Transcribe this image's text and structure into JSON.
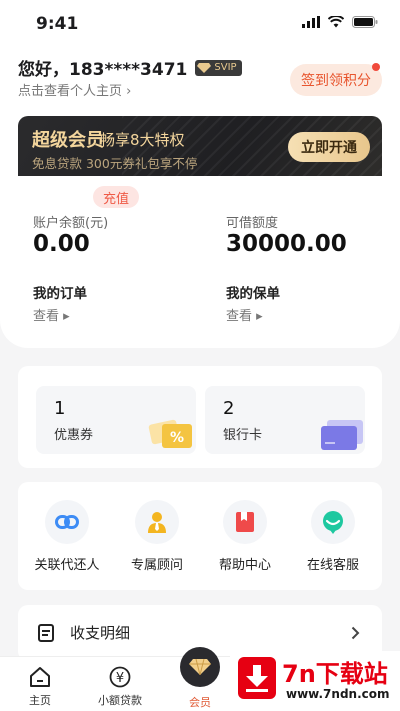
{
  "status_bar": {
    "time": "9:41"
  },
  "user": {
    "greeting": "您好，183****3471",
    "badge": "SVIP",
    "profile_link": "点击查看个人主页 ›"
  },
  "signin_button": "签到领积分",
  "vip_banner": {
    "title": "超级会员",
    "highlight": "畅享8大特权",
    "subtitle": "免息贷款   300元券礼包享不停",
    "button": "立即开通"
  },
  "account": {
    "balance_label": "账户余额(元)",
    "balance_value": "0.00",
    "recharge_label": "充值",
    "credit_label": "可借额度",
    "credit_value": "30000.00",
    "orders_title": "我的订单",
    "orders_link": "查看 ▸",
    "policies_title": "我的保单",
    "policies_link": "查看 ▸"
  },
  "assets": [
    {
      "count": "1",
      "label": "优惠券",
      "icon": "coupon-icon"
    },
    {
      "count": "2",
      "label": "银行卡",
      "icon": "bank-card-icon"
    }
  ],
  "services": [
    {
      "label": "关联代还人",
      "icon": "link-icon"
    },
    {
      "label": "专属顾问",
      "icon": "advisor-icon"
    },
    {
      "label": "帮助中心",
      "icon": "help-book-icon"
    },
    {
      "label": "在线客服",
      "icon": "chat-service-icon"
    }
  ],
  "ledger": {
    "label": "收支明细",
    "icon": "document-icon"
  },
  "tabbar": [
    {
      "label": "主页",
      "icon": "home-icon"
    },
    {
      "label": "小额贷款",
      "icon": "yuan-icon"
    },
    {
      "label": "会员",
      "icon": "diamond-icon"
    }
  ],
  "watermark": {
    "brand": "7n下载站",
    "url": "www.7ndn.com"
  },
  "colors": {
    "accent": "#e8552e",
    "gold": "#f3d59c",
    "dark": "#2b2b2d",
    "brand_red": "#e60012"
  }
}
